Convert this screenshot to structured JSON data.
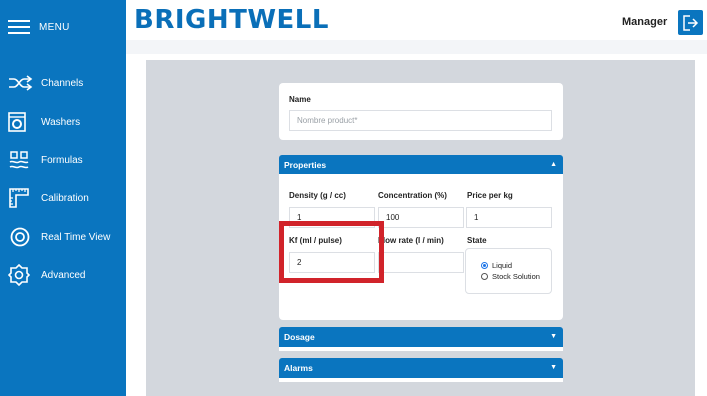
{
  "sidebar": {
    "menu_label": "MENU",
    "items": [
      {
        "label": "Channels",
        "icon": "shuffle-icon"
      },
      {
        "label": "Washers",
        "icon": "washer-icon"
      },
      {
        "label": "Formulas",
        "icon": "formula-icon"
      },
      {
        "label": "Calibration",
        "icon": "calibration-icon"
      },
      {
        "label": "Real Time View",
        "icon": "eye-icon"
      },
      {
        "label": "Advanced",
        "icon": "gear-icon"
      }
    ]
  },
  "header": {
    "brand": "BRIGHTWELL",
    "user": "Manager"
  },
  "form": {
    "name_label": "Name",
    "name_placeholder": "Nombre product*",
    "properties_title": "Properties",
    "density_label": "Density (g / cc)",
    "density_value": "1",
    "concentration_label": "Concentration (%)",
    "concentration_value": "100",
    "price_label": "Price per kg",
    "price_value": "1",
    "kf_label": "Kf (ml / pulse)",
    "kf_value": "2",
    "flow_label": "Flow rate (l / min)",
    "flow_value": "",
    "state_label": "State",
    "state_options": [
      "Liquid",
      "Stock Solution"
    ],
    "state_selected": "Liquid",
    "dosage_title": "Dosage",
    "alarms_title": "Alarms"
  },
  "colors": {
    "primary": "#0a75bf",
    "highlight": "#d1232a",
    "content_bg": "#d3d7dd"
  }
}
